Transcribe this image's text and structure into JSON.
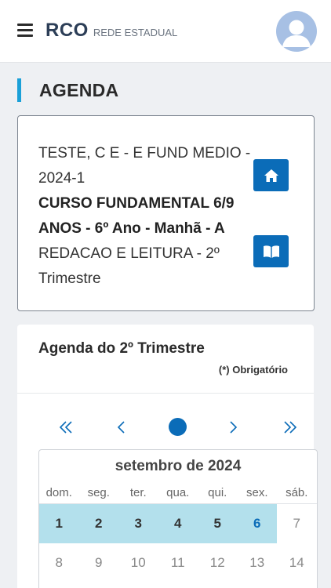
{
  "header": {
    "logo": "RCO",
    "subtitle": "REDE ESTADUAL"
  },
  "page": {
    "title": "AGENDA"
  },
  "info": {
    "school": "TESTE, C E - E FUND MEDIO - 2024-1",
    "course": "CURSO FUNDAMENTAL 6/9 ANOS - 6º Ano - Manhã - A",
    "subject": "REDACAO E LEITURA - 2º Trimestre"
  },
  "agenda": {
    "title": "Agenda do 2º Trimestre",
    "required": "(*) Obrigatório"
  },
  "calendar": {
    "month": "setembro de 2024",
    "weekdays": [
      "dom.",
      "seg.",
      "ter.",
      "qua.",
      "qui.",
      "sex.",
      "sáb."
    ],
    "weeks": [
      [
        "1",
        "2",
        "3",
        "4",
        "5",
        "6",
        "7"
      ],
      [
        "8",
        "9",
        "10",
        "11",
        "12",
        "13",
        "14"
      ]
    ],
    "highlight_color": "#b3e0ec",
    "accent_color": "#0b6cb8"
  },
  "icons": {
    "menu": "hamburger-icon",
    "avatar": "user-avatar-icon",
    "home": "home-icon",
    "book": "book-icon",
    "first": "double-chevron-left-icon",
    "prev": "chevron-left-icon",
    "today": "dot-icon",
    "next": "chevron-right-icon",
    "last": "double-chevron-right-icon"
  }
}
